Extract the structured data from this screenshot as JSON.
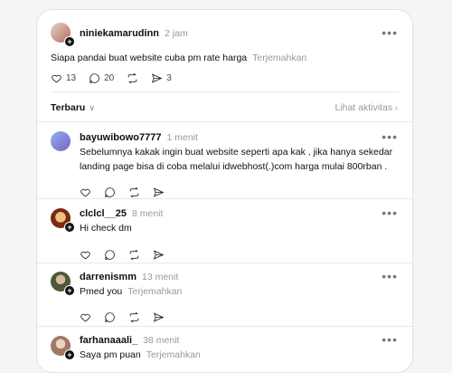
{
  "post": {
    "username": "niniekamarudinn",
    "time": "2 jam",
    "text": "Siapa pandai buat website cuba pm rate harga",
    "translate": "Terjemahkan",
    "likes": "13",
    "replies": "20",
    "shares": "3"
  },
  "filter": {
    "label": "Terbaru",
    "activity": "Lihat aktivitas"
  },
  "comments": [
    {
      "username": "bayuwibowo7777",
      "time": "1 menit",
      "line1": "Sebelumnya kakak ingin buat website seperti apa kak , jika hanya sekedar",
      "line2": "landing page bisa di coba melalui idwebhost(.)com harga mulai 800rban .",
      "avatar_color": "#7b7bd6"
    },
    {
      "username": "clclcl__25",
      "time": "8 menit",
      "line1": "Hi check dm",
      "avatar_color": "#a0522d"
    },
    {
      "username": "darrenismm",
      "time": "13 menit",
      "line1": "Pmed you",
      "translate": "Terjemahkan",
      "avatar_color": "#556b2f"
    },
    {
      "username": "farhanaaali_",
      "time": "38 menit",
      "line1": "Saya pm puan",
      "translate": "Terjemahkan",
      "avatar_color": "#c49a8a"
    }
  ]
}
